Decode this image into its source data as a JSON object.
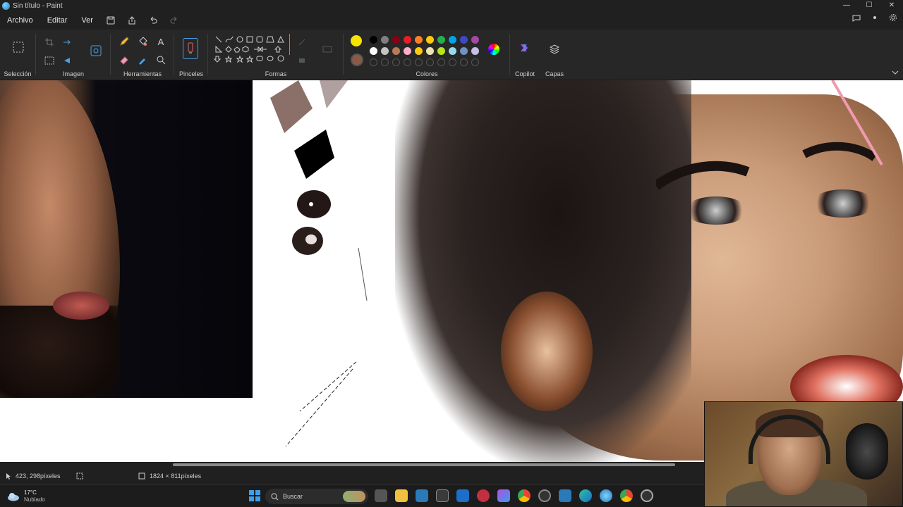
{
  "window": {
    "title": "Sin título - Paint",
    "controls": [
      "—",
      "☐",
      "✕"
    ]
  },
  "menu": {
    "items": [
      "Archivo",
      "Editar",
      "Ver"
    ]
  },
  "ribbon": {
    "groups": {
      "selection": "Selección",
      "image": "Imagen",
      "tools": "Herramientas",
      "brushes": "Pinceles",
      "shapes": "Formas",
      "colors": "Colores",
      "copilot": "Copilot",
      "layers": "Capas"
    },
    "color_palette": {
      "active_primary": "#f7e300",
      "active_secondary": "#8a5a46",
      "row1": [
        "#000000",
        "#7f7f7f",
        "#880015",
        "#ed1c24",
        "#ff7f27",
        "#ffc90e",
        "#22b14c",
        "#00a2e8",
        "#3f48cc",
        "#a349a4",
        "#b97a57"
      ],
      "row2": [
        "#ffffff",
        "#c3c3c3",
        "#b97a57",
        "#ffaec9",
        "#ffc90e",
        "#efe4b0",
        "#b5e61d",
        "#99d9ea",
        "#7092be",
        "#c8bfe7"
      ]
    }
  },
  "status": {
    "cursor_position": "423, 298píxeles",
    "canvas_size": "1824 × 811píxeles"
  },
  "taskbar": {
    "weather_temp": "17°C",
    "weather_desc": "Nublado",
    "search_placeholder": "Buscar"
  }
}
